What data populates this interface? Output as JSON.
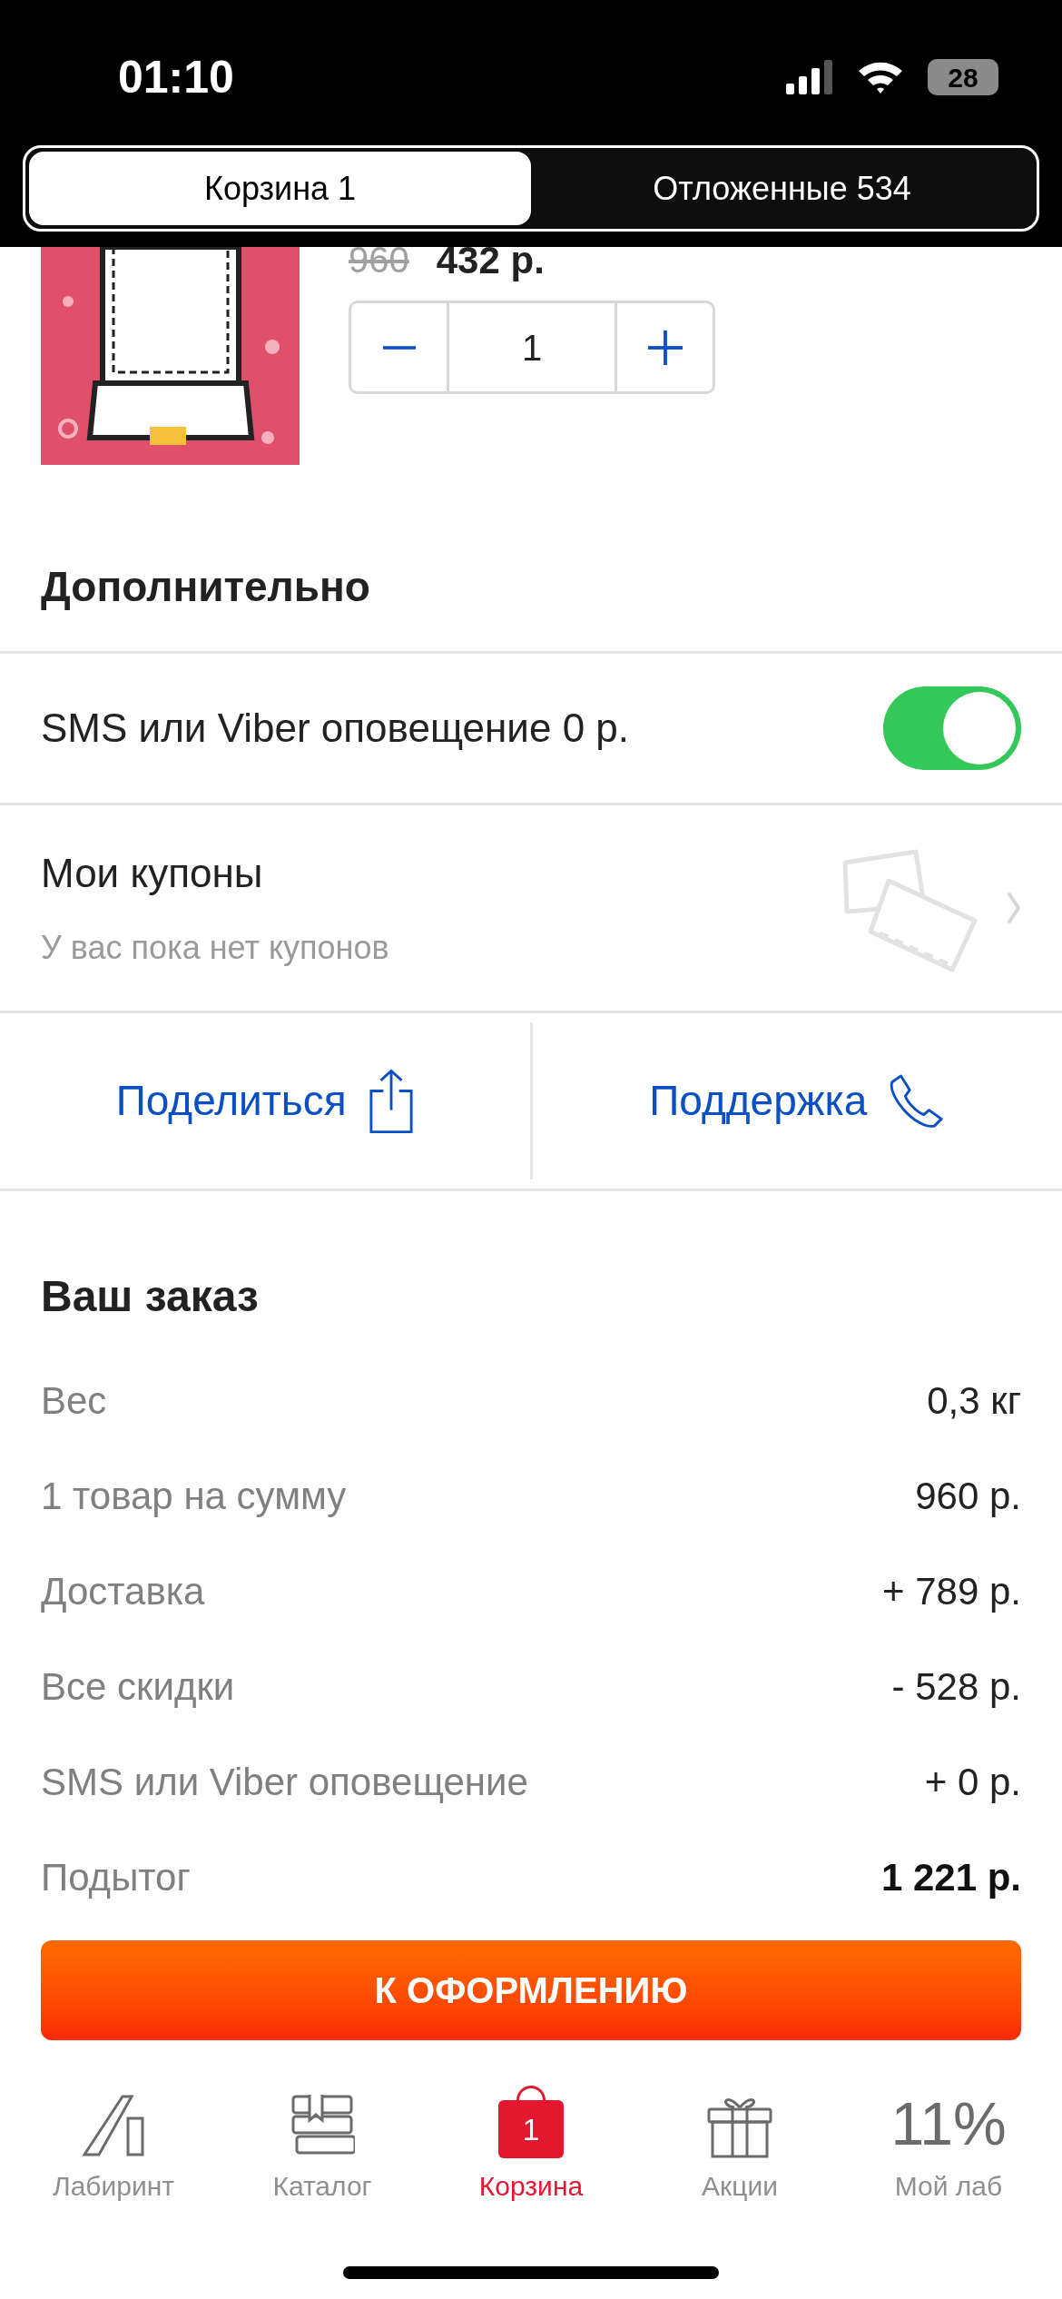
{
  "status_bar": {
    "time": "01:10",
    "battery": "28"
  },
  "segments": [
    {
      "label": "Корзина 1",
      "selected": true
    },
    {
      "label": "Отложенные 534",
      "selected": false
    }
  ],
  "product": {
    "old_price": "960",
    "price": "432 р.",
    "quantity": "1"
  },
  "extras": {
    "title": "Дополнительно",
    "sms": {
      "label": "SMS или Viber оповещение 0 р.",
      "on": true
    },
    "coupons": {
      "title": "Мои купоны",
      "subtitle": "У вас пока нет купонов"
    }
  },
  "actions": [
    {
      "label": "Поделиться",
      "kind": "share"
    },
    {
      "label": "Поддержка",
      "kind": "support"
    }
  ],
  "order": {
    "title": "Ваш заказ",
    "rows": [
      {
        "label": "Вес",
        "value": "0,3 кг",
        "kind": "line"
      },
      {
        "label": "1 товар на сумму",
        "value": "960 р.",
        "kind": "line"
      },
      {
        "label": "Доставка",
        "value": "+ 789 р.",
        "kind": "line"
      },
      {
        "label": "Все скидки",
        "value": "- 528 р.",
        "kind": "line"
      },
      {
        "label": "SMS или Viber оповещение",
        "value": "+ 0 р.",
        "kind": "line"
      },
      {
        "label": "Подытог",
        "value": "1 221 р.",
        "kind": "total"
      }
    ]
  },
  "checkout_button": "К ОФОРМЛЕНИЮ",
  "tab_bar": [
    {
      "label": "Лабиринт",
      "kind": "logo",
      "selected": false
    },
    {
      "label": "Каталог",
      "kind": "catalog",
      "selected": false
    },
    {
      "label": "Корзина",
      "kind": "cart",
      "badge": "1",
      "selected": true
    },
    {
      "label": "Акции",
      "kind": "gift",
      "selected": false
    },
    {
      "label": "Мой лаб",
      "kind": "percent",
      "value": "11%",
      "selected": false
    }
  ]
}
